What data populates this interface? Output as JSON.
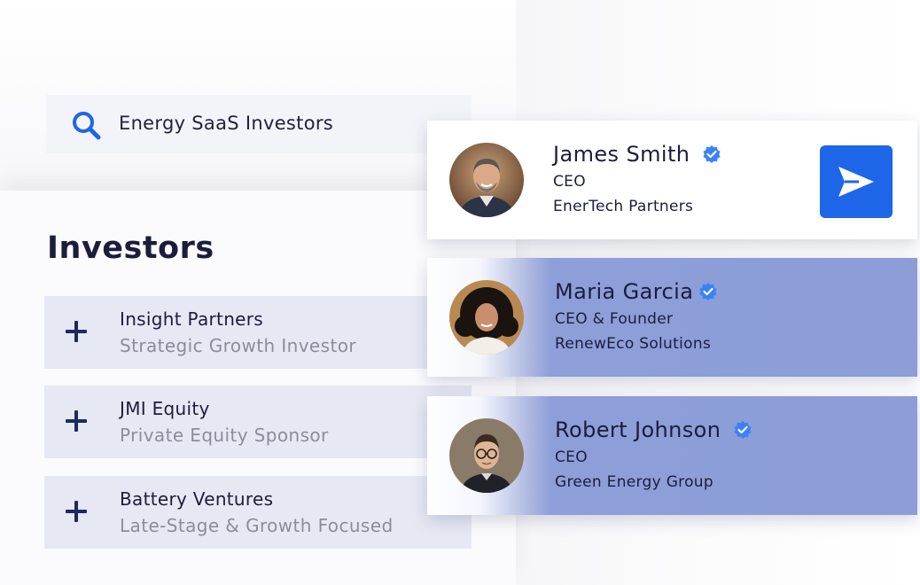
{
  "search": {
    "query": "Energy SaaS Investors",
    "icon": "search-icon"
  },
  "investors": {
    "title": "Investors",
    "items": [
      {
        "name": "Insight Partners",
        "description": "Strategic Growth Investor",
        "icon": "plus-icon"
      },
      {
        "name": "JMI Equity",
        "description": "Private Equity Sponsor",
        "icon": "plus-icon"
      },
      {
        "name": "Battery Ventures",
        "description": "Late-Stage & Growth Focused",
        "icon": "plus-icon"
      }
    ]
  },
  "contacts": [
    {
      "name": "James Smith",
      "role": "CEO",
      "company": "EnerTech Partners",
      "verified": true,
      "avatar": "avatar-man-gray-beard"
    },
    {
      "name": "Maria Garcia",
      "role": "CEO & Founder",
      "company": "RenewEco Solutions",
      "verified": true,
      "avatar": "avatar-woman-curly-hair"
    },
    {
      "name": "Robert Johnson",
      "role": "CEO",
      "company": "Green Energy Group",
      "verified": true,
      "avatar": "avatar-man-glasses"
    }
  ],
  "actions": {
    "send_icon": "send-icon"
  },
  "colors": {
    "accent": "#1e66e8",
    "verified": "#3b82f6",
    "row_bg": "#e6e8f3",
    "highlight": "#8c9dd8",
    "text_dark": "#1b1d3c",
    "text_muted": "#8b8d9c"
  }
}
